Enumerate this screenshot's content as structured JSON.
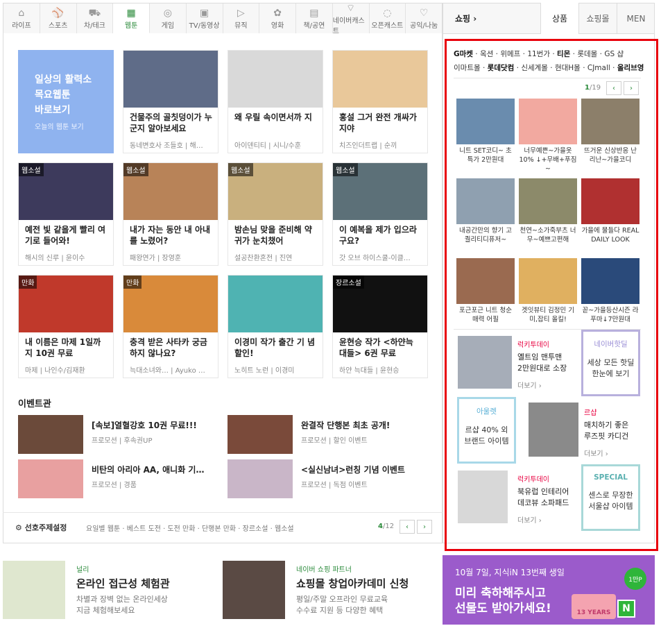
{
  "tabs": [
    {
      "label": "라이프",
      "icon": "home-icon"
    },
    {
      "label": "스포츠",
      "icon": "ball-icon"
    },
    {
      "label": "차/테크",
      "icon": "car-icon"
    },
    {
      "label": "웹툰",
      "icon": "webtoon-icon"
    },
    {
      "label": "게임",
      "icon": "gamepad-icon"
    },
    {
      "label": "TV/동영상",
      "icon": "tv-icon"
    },
    {
      "label": "뮤직",
      "icon": "play-icon"
    },
    {
      "label": "영화",
      "icon": "film-icon"
    },
    {
      "label": "책/공연",
      "icon": "book-icon"
    },
    {
      "label": "네이버캐스트",
      "icon": "broadcast-icon"
    },
    {
      "label": "오픈캐스트",
      "icon": "opencast-icon"
    },
    {
      "label": "공익/나눔",
      "icon": "heart-icon"
    }
  ],
  "promo": {
    "title1": "일상의 활력소",
    "title2": "목요웹툰",
    "title3": "바로보기",
    "sub": "오늘의 웹툰 보기"
  },
  "cards": [
    {
      "badge": "",
      "title": "건물주의 골칫덩이가 누군지 알아보세요",
      "meta": "동네변호사 조들호 | 해…",
      "color": "#5f6c88"
    },
    {
      "badge": "",
      "title": "왜 우릴 속이면서까 지",
      "meta": "아이덴티티 | 시니/수훈",
      "color": "#d9d9d9"
    },
    {
      "badge": "",
      "title": "홍설 그거 완전 개싸가지야",
      "meta": "치즈인더트랩 | 순끼",
      "color": "#e9c89a"
    },
    {
      "badge": "웹소설",
      "title": "예전 빛 같을게 빨리 여기로 들어와!",
      "meta": "해시의 신루 | 윤이수",
      "color": "#3d3a5c"
    },
    {
      "badge": "웹소설",
      "title": "내가 자는 동안 내 아내를 노렸어?",
      "meta": "패왕연가 | 장영훈",
      "color": "#b88358"
    },
    {
      "badge": "웹소설",
      "title": "밤손님 맞을 준비해 약귀가 눈치챘어",
      "meta": "설공찬환혼전 | 진연",
      "color": "#c9b07e"
    },
    {
      "badge": "웹소설",
      "title": "이 예복을 제가 입으라구요?",
      "meta": "갓 오브 하이스쿨-이클…",
      "color": "#5c7078"
    },
    {
      "badge": "만화",
      "title": "내 이름은 마제 1일까지 10권 무료",
      "meta": "마제 | 나인수/김재환",
      "color": "#c0392b"
    },
    {
      "badge": "만화",
      "title": "충격 받은 사타카 궁금하지 않나요?",
      "meta": "늑대소녀와… | Ayuko …",
      "color": "#d98a3a"
    },
    {
      "badge": "",
      "title": "이경미 작가 출간 기 념 할인!",
      "meta": "노히트 노런 | 이경미",
      "color": "#4fb3b2"
    },
    {
      "badge": "장르소설",
      "title": "윤현승 작가 <하얀늑 대들> 6권 무료",
      "meta": "하얀 늑대들 | 윤현승",
      "color": "#111111"
    }
  ],
  "events": {
    "heading": "이벤트관",
    "items": [
      {
        "title": "[속보]열혈강호 10권 무료!!!",
        "sub": "프로모션 | 후속권UP",
        "color": "#6b4a3a"
      },
      {
        "title": "완결작 단행본 최초 공개!",
        "sub": "프로모션 | 할인 이벤트",
        "color": "#7a4a3a"
      },
      {
        "title": "비탄의 아리아 AA, 애니화 기…",
        "sub": "프로모션 | 경품",
        "color": "#e8a0a0"
      },
      {
        "title": "<실신남녀>런칭 기념 이벤트",
        "sub": "프로모션 | 독점 이벤트",
        "color": "#c9b6c8"
      }
    ]
  },
  "bottom": {
    "setting": "선호주제설정",
    "links": "요일별 웹툰 · 베스트 도전 · 도전 만화 · 단행본 만화 · 장르소설 · 웹소설",
    "page_current": "4",
    "page_total": "/12"
  },
  "shop": {
    "label": "쇼핑",
    "tabs": [
      "상품",
      "쇼핑몰",
      "MEN"
    ],
    "brands_row1": [
      "G마켓",
      "옥션",
      "위메프",
      "11번가",
      "티몬",
      "롯데몰",
      "GS 샵"
    ],
    "brands_row2": [
      "이마트몰",
      "롯데닷컴",
      "신세계몰",
      "현대H몰",
      "CJmall",
      "올리브영"
    ],
    "page_current": "1",
    "page_total": "/19",
    "products": [
      {
        "text": "니트 SET코디~ 초특가 2만원대",
        "color": "#6a8cae"
      },
      {
        "text": "너무예쁜~가을옷 10% ↓+무배+푸짐~",
        "color": "#f2a9a0"
      },
      {
        "text": "뜨거운 신상반응 난리난~가을코디",
        "color": "#8c7f6a"
      },
      {
        "text": "내공간만의 향기 고퀄리티디퓨저~",
        "color": "#8fa0b0"
      },
      {
        "text": "천연~소가죽부츠 너무~예쁘고편해",
        "color": "#8c8a6a"
      },
      {
        "text": "가을에 물들다 REAL DAILY LOOK",
        "color": "#b03030"
      },
      {
        "text": "포근포근 니트 청순매력 어필",
        "color": "#9a6a50"
      },
      {
        "text": "겟잇뷰티 김정민 기미,잡티 올킬!",
        "color": "#e0b060"
      },
      {
        "text": "꼳~가을등산시즌 라푸마↓7만원대",
        "color": "#2a4a7a"
      }
    ],
    "deal1": {
      "cat": "럭키투데이",
      "text1": "옐트임 맨투맨",
      "text2": "2만원대로 소장",
      "more": "더보기 ›"
    },
    "box1": {
      "title": "네이버핫딜",
      "d1": "세상 모든 핫딜",
      "d2": "한눈에 보기",
      "color": "#9b8fd6"
    },
    "box2": {
      "title": "아울렛",
      "d1": "르샵 40% 외",
      "d2": "브랜드 아이템",
      "color": "#5ab0d6"
    },
    "deal2": {
      "cat": "르샵",
      "text1": "매치하기 좋은",
      "text2": "루즈핏 카디건",
      "more": "더보기 ›"
    },
    "deal3": {
      "cat": "럭키투데이",
      "text1": "북유럽 인테리어",
      "text2": "데코뷰 소파패드",
      "more": "더보기 ›"
    },
    "box3": {
      "title": "SPECIAL",
      "d1": "센스로 무장한",
      "d2": "서울샵 아이템",
      "color": "#5ab0b0"
    }
  },
  "footer": {
    "b1": {
      "cat": "널리",
      "title": "온라인 접근성 체험관",
      "d1": "차별과 장벽 없는 온라인세상",
      "d2": "지금 체험해보세요"
    },
    "b2": {
      "cat": "네이버 쇼핑 파트너",
      "title": "쇼핑몰 창업아카데미 신청",
      "d1": "평일/주말 오프라인 무료교육",
      "d2": "수수료 지원 등 다양한 혜택"
    },
    "ad": {
      "line1": "10월 7일, 지식iN 13번째 생일",
      "line2": "미리 축하해주시고",
      "line3": "선물도 받아가세요!",
      "badge": "1만P",
      "cake": "13 YEARS",
      "logo": "N"
    }
  },
  "colors": {
    "accent": "#2a8a3a",
    "highlight": "#e8000b",
    "promo": "#8fb3ef",
    "ad": "#9b5bcb"
  }
}
